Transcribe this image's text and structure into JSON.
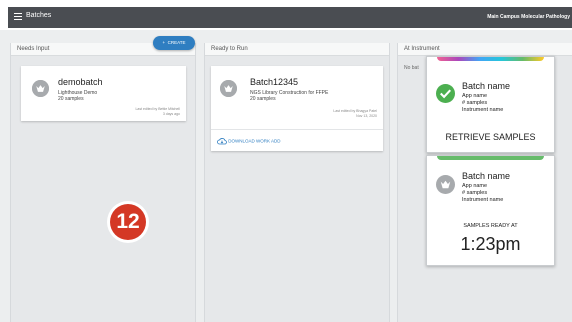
{
  "header": {
    "title": "Batches",
    "location": "Main Campus Molecular Pathology"
  },
  "create_button": {
    "label": "CREATE"
  },
  "columns": [
    {
      "title": "Needs Input"
    },
    {
      "title": "Ready to Run"
    },
    {
      "title": "At Instrument",
      "note": "No bat"
    }
  ],
  "needs_input_card": {
    "name": "demobatch",
    "app": "Lighthouse Demo",
    "samples": "20 samples",
    "edited": "Last edited by Bettie Mitchell",
    "when": "3 days ago"
  },
  "ready_card": {
    "name": "Batch12345",
    "app": "NGS Library Construction for FFPE",
    "samples": "20 samples",
    "edited": "Last edited by Bhagya Patel",
    "when": "Nov 13, 2020",
    "download": "DOWNLOAD WORK ADD"
  },
  "badge": {
    "number": "12"
  },
  "instrument_cards": [
    {
      "name": "Batch name",
      "app": "App name",
      "samples": "# samples",
      "instrument": "Instrument name",
      "action": "RETRIEVE SAMPLES"
    },
    {
      "name": "Batch name",
      "app": "App name",
      "samples": "# samples",
      "instrument": "Instrument name",
      "ready_label": "SAMPLES READY AT",
      "time": "1:23pm"
    }
  ],
  "colors": {
    "accent": "#2f7ec1",
    "badge": "#d43825",
    "check": "#4caf50",
    "appbar": "#4a4d52"
  },
  "icons": [
    "menu-icon",
    "plus-icon",
    "user-avatar-icon",
    "check-icon",
    "download-icon"
  ]
}
